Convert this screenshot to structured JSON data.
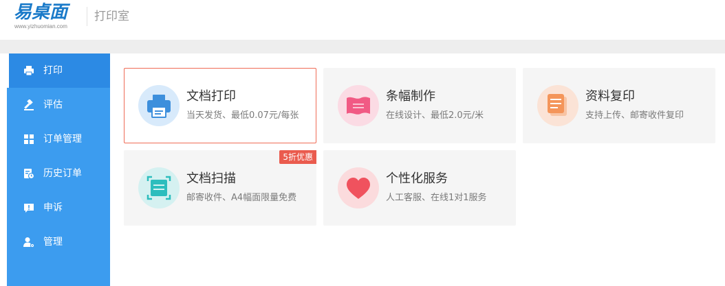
{
  "header": {
    "logo_text": "易桌面",
    "logo_domain": "www.yizhuomian.com",
    "page_title": "打印室"
  },
  "sidebar": {
    "active_index": 0,
    "items": [
      {
        "label": "打印",
        "icon": "printer-icon"
      },
      {
        "label": "评估",
        "icon": "gavel-icon"
      },
      {
        "label": "订单管理",
        "icon": "grid-icon"
      },
      {
        "label": "历史订单",
        "icon": "history-icon"
      },
      {
        "label": "申诉",
        "icon": "complaint-icon"
      },
      {
        "label": "管理",
        "icon": "user-settings-icon"
      }
    ]
  },
  "services": [
    {
      "title": "文档打印",
      "subtitle": "当天发货、最低0.07元/每张",
      "icon": "printer-icon",
      "icon_bg": "#d8eafb",
      "icon_color": "#3d8fdc",
      "selected": true
    },
    {
      "title": "条幅制作",
      "subtitle": "在线设计、最低2.0元/米",
      "icon": "banner-icon",
      "icon_bg": "#fbdbe4",
      "icon_color": "#f15a84"
    },
    {
      "title": "资料复印",
      "subtitle": "支持上传、邮寄收件复印",
      "icon": "copy-icon",
      "icon_bg": "#fbe3d6",
      "icon_color": "#f4955a"
    },
    {
      "title": "文档扫描",
      "subtitle": "邮寄收件、A4幅面限量免费",
      "icon": "scan-icon",
      "icon_bg": "#d5f1f1",
      "icon_color": "#2dbdbd",
      "badge": "5折优惠"
    },
    {
      "title": "个性化服务",
      "subtitle": "人工客服、在线1对1服务",
      "icon": "heart-icon",
      "icon_bg": "#fbdbdd",
      "icon_color": "#f0525e"
    }
  ],
  "colors": {
    "sidebar_bg": "#3c9cef",
    "sidebar_active": "#2c8ae4",
    "selected_border": "#ef6b55",
    "badge": "#ea5b4e"
  }
}
